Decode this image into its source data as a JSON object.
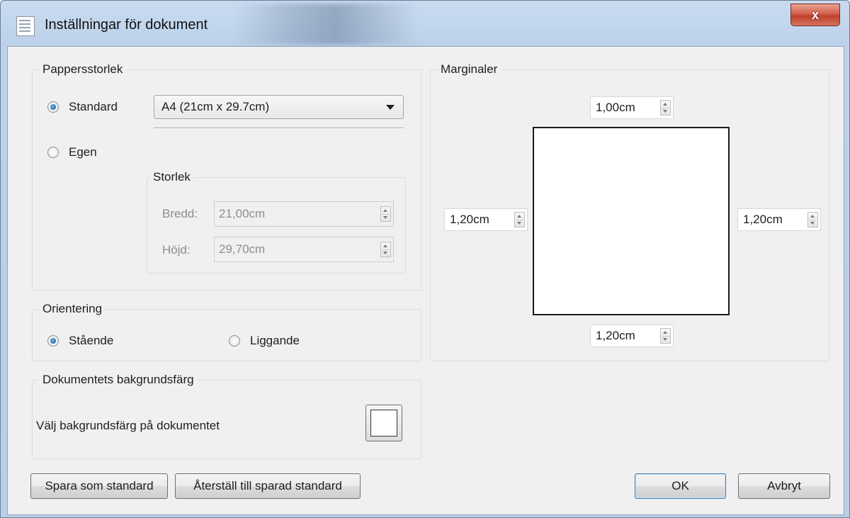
{
  "window": {
    "title": "Inställningar för dokument",
    "close_label": "x"
  },
  "paper_size": {
    "group_label": "Pappersstorlek",
    "standard_label": "Standard",
    "standard_selected": true,
    "standard_value": "A4 (21cm x 29.7cm)",
    "custom_label": "Egen",
    "custom_selected": false,
    "size_group_label": "Storlek",
    "width_label": "Bredd:",
    "width_value": "21,00cm",
    "height_label": "Höjd:",
    "height_value": "29,70cm"
  },
  "orientation": {
    "group_label": "Orientering",
    "portrait_label": "Stående",
    "portrait_selected": true,
    "landscape_label": "Liggande",
    "landscape_selected": false
  },
  "background": {
    "group_label": "Dokumentets bakgrundsfärg",
    "prompt": "Välj bakgrundsfärg på dokumentet",
    "color": "#ffffff"
  },
  "margins": {
    "group_label": "Marginaler",
    "top": "1,00cm",
    "left": "1,20cm",
    "right": "1,20cm",
    "bottom": "1,20cm"
  },
  "buttons": {
    "save_default": "Spara som standard",
    "restore_default": "Återställ till sparad standard",
    "ok": "OK",
    "cancel": "Avbryt"
  }
}
